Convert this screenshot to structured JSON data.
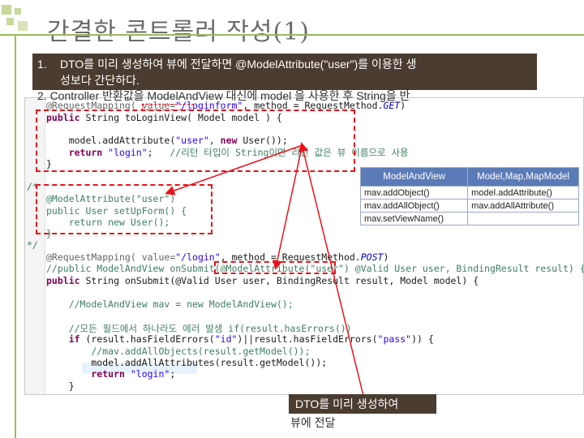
{
  "slide": {
    "title": "간결한 콘트롤러 작성(1)"
  },
  "notes": {
    "item1_num": "1.",
    "item1_line1": "DTO를 미리 생성하여 뷰에 전달하면  @ModelAttribute(\"user\")를 이용한  생",
    "item1_line2": "성보다 간단하다.",
    "item2": "2.  Controller 반환값을  ModelAndView 대신에  model 을 사용한 후  String을  반"
  },
  "code": {
    "l1a": "@RequestMapping( value=",
    "l1b": "\"/loginform\"",
    "l1c": ", method = RequestMethod.",
    "l1d": "GET",
    "l1e": ")",
    "l2a": "public",
    "l2b": " String ",
    "l2c": "toLoginView( Model model ) {",
    "l3": "    model.addAttribute(",
    "l3s": "\"user\"",
    "l3b": ", ",
    "l3k": "new",
    "l3c": " User());",
    "l4a": "    return ",
    "l4s": "\"login\"",
    "l4b": ";   ",
    "l4c": "//리턴 타입이 String이면 리턴 값은 뷰 이름으로 사용",
    "l5": "}",
    "l6": "/*",
    "l7a": "@ModelAttribute(",
    "l7s": "\"user\"",
    "l7b": ")",
    "l8a": "public",
    "l8b": " User setUpForm() {",
    "l9a": "    return ",
    "l9k": "new",
    "l9b": " User();",
    "l10": "}",
    "l11": "*/",
    "l12a": "@RequestMapping( value=",
    "l12s": "\"/login\"",
    "l12b": ", method = RequestMethod.",
    "l12c": "POST",
    "l12d": ")",
    "l13": "//public ModelAndView onSubmit(@ModelAttribute(\"user\") @Valid User user, BindingResult result) {",
    "l14a": "public",
    "l14b": " String",
    "l14c": " onSubmit(@Valid User user, BindingResult result, Model model) {",
    "l15": "    //ModelAndView mav = new ModelAndView();",
    "l16": "    //모든 필드에서 하나라도 에러 발생 if(result.hasErrors())",
    "l17a": "    if",
    "l17b": " (result.hasFieldErrors(",
    "l17s1": "\"id\"",
    "l17c": ")||result.hasFieldErrors(",
    "l17s2": "\"pass\"",
    "l17d": ")) {",
    "l18": "        //mav.addAllObjects(result.getModel());",
    "l19": "        model.addAllAttributes(result.getModel());",
    "l20a": "        return ",
    "l20s": "\"login\"",
    "l20b": ";",
    "l21": "    }"
  },
  "mav_table": {
    "col1_header": "ModelAndView",
    "col2_header": "Model,Map,MapModel",
    "rows": [
      {
        "left": "mav.addObject()",
        "right": "model.addAttribute()"
      },
      {
        "left": "mav.addAllObject()",
        "right": "mav.addAllAttribute()"
      },
      {
        "left": "mav.setViewName()",
        "right": ""
      }
    ]
  },
  "callout": {
    "line1": "DTO를 미리 생성하여",
    "line2": "뷰에 전달"
  },
  "colors": {
    "accent_green": "#9cbb59",
    "note_bg": "#4a3c30",
    "red_box": "#e8121a",
    "table_header": "#5b7bb8"
  }
}
